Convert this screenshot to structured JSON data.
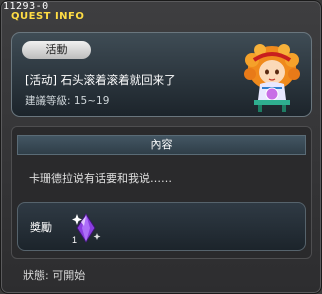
{
  "window": {
    "quest_id": "11293-0",
    "title": "QUEST INFO"
  },
  "quest": {
    "badge": "活動",
    "name": "[活动] 石头滚着滚着就回来了",
    "level_text": "建議等級: 15~19",
    "npc_icon": "npc-girl-portrait"
  },
  "content": {
    "header": "內容",
    "text": "卡珊德拉说有话要和我说……",
    "reward_label": "獎勵",
    "reward_icon": "purple-gem-icon",
    "reward_quantity": "1"
  },
  "status": {
    "text": "狀態: 可開始"
  },
  "colors": {
    "title": "#ffdd44",
    "gem": "#8a3de0"
  }
}
